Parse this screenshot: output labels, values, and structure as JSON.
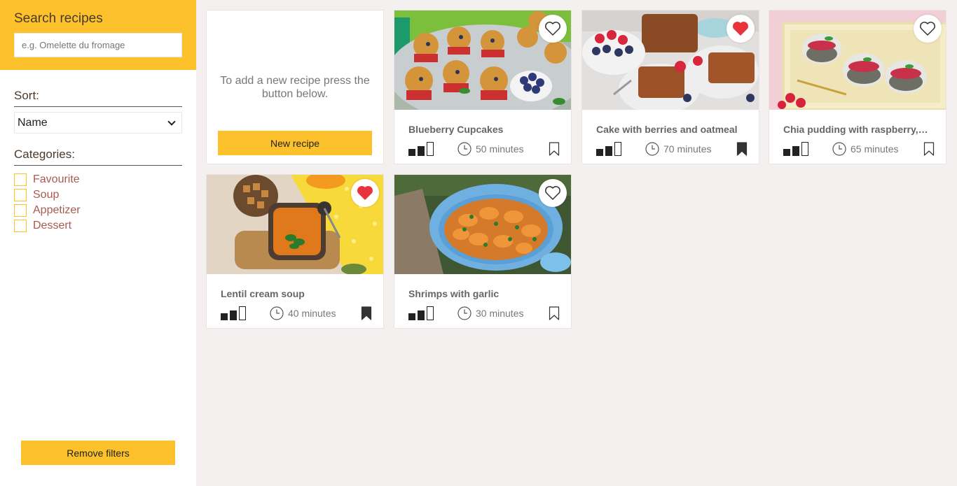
{
  "sidebar": {
    "search_title": "Search recipes",
    "search_placeholder": "e.g. Omelette du fromage",
    "sort_label": "Sort:",
    "sort_value": "Name",
    "categories_label": "Categories:",
    "categories": [
      "Favourite",
      "Soup",
      "Appetizer",
      "Dessert"
    ],
    "remove_filters": "Remove filters"
  },
  "new_recipe": {
    "text": "To add a new recipe press the button below.",
    "button": "New recipe"
  },
  "recipes": [
    {
      "title": "Blueberry Cupcakes",
      "time": "50 minutes",
      "favourite": false,
      "bookmarked": false,
      "difficulty": 2
    },
    {
      "title": "Cake with berries and oatmeal",
      "time": "70 minutes",
      "favourite": true,
      "bookmarked": true,
      "difficulty": 2
    },
    {
      "title": "Chia pudding with raspberry,blueberry",
      "time": "65 minutes",
      "favourite": false,
      "bookmarked": false,
      "difficulty": 2
    },
    {
      "title": "Lentil cream soup",
      "time": "40 minutes",
      "favourite": true,
      "bookmarked": true,
      "difficulty": 2
    },
    {
      "title": "Shrimps with garlic",
      "time": "30 minutes",
      "favourite": false,
      "bookmarked": false,
      "difficulty": 2
    }
  ],
  "colors": {
    "accent": "#fcc12b",
    "heart": "#e8323c",
    "category_text": "#a85a50"
  },
  "icons": [
    "heart-icon",
    "clock-icon",
    "bookmark-icon",
    "difficulty-icon",
    "chevron-down-icon"
  ]
}
